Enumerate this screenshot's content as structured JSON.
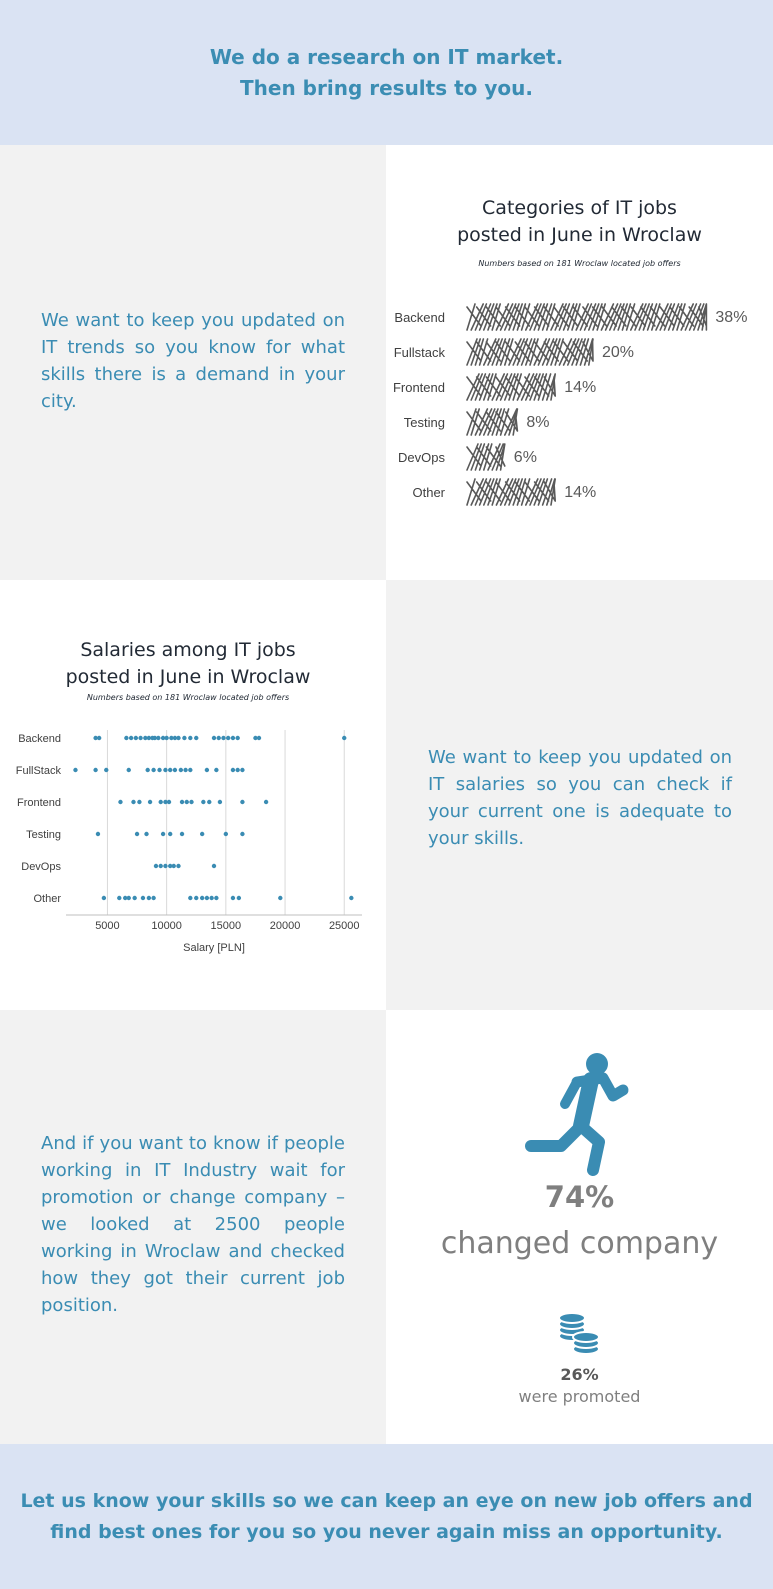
{
  "header": {
    "title": "We do a research on IT market.\nThen bring results to you."
  },
  "section1": {
    "text": "We want to keep you updated on IT trends so you know for what skills there is a demand in your city."
  },
  "section2": {
    "text": "We want to keep you updated on IT salaries so you can check if your current one is adequate to your skills."
  },
  "section3": {
    "text": "And if you want to know if people working in IT Industry wait for promotion or change company – we looked at 2500 people working in Wroclaw and checked how they got their current job position.",
    "changed_value": "74%",
    "changed_label": "changed company",
    "promoted_value": "26%",
    "promoted_label": "were promoted",
    "icons": [
      "running-person-icon",
      "coins-icon"
    ]
  },
  "footer": {
    "text": "Let us know your skills so we can keep an eye on new job offers and\nfind best ones for you so you never again miss an opportunity."
  },
  "colors": {
    "accent": "#3a8cb3",
    "band": "#dae3f3",
    "panel": "#f2f2f2",
    "hatch": "#595959",
    "dots": "#3a8cb3"
  },
  "chart_data": [
    {
      "type": "bar",
      "orientation": "horizontal",
      "title": "Categories of IT jobs\nposted in June in Wroclaw",
      "subtitle": "Numbers based on 181 Wroclaw located job offers",
      "categories": [
        "Backend",
        "Fullstack",
        "Frontend",
        "Testing",
        "DevOps",
        "Other"
      ],
      "values": [
        38,
        20,
        14,
        8,
        6,
        14
      ],
      "labels": [
        "38%",
        "20%",
        "14%",
        "8%",
        "6%",
        "14%"
      ],
      "style": "hand-drawn hatched bars",
      "grid": false
    },
    {
      "type": "scatter",
      "title": "Salaries among IT jobs\nposted in June in Wroclaw",
      "subtitle": "Numbers based on 181 Wroclaw located job offers",
      "xlabel": "Salary [PLN]",
      "xticks": [
        5000,
        10000,
        15000,
        20000,
        25000
      ],
      "xlim": [
        1500,
        26500
      ],
      "categories": [
        "Backend",
        "FullStack",
        "Frontend",
        "Testing",
        "DevOps",
        "Other"
      ],
      "series": [
        {
          "category": "Backend",
          "values": [
            4000,
            4300,
            6600,
            7000,
            7400,
            7800,
            8200,
            8500,
            8800,
            9000,
            9300,
            9700,
            10000,
            10400,
            10700,
            11000,
            11500,
            12000,
            12500,
            14000,
            14400,
            14800,
            15200,
            15600,
            16000,
            17500,
            17800,
            25000
          ]
        },
        {
          "category": "FullStack",
          "values": [
            2300,
            4000,
            4900,
            6800,
            8400,
            8900,
            9400,
            9900,
            10300,
            10700,
            11200,
            11600,
            12000,
            13400,
            14200,
            15600,
            16000,
            16400
          ]
        },
        {
          "category": "Frontend",
          "values": [
            6100,
            7200,
            7700,
            8600,
            9500,
            9900,
            10200,
            11300,
            11700,
            12100,
            13100,
            13600,
            14500,
            16400,
            18400
          ]
        },
        {
          "category": "Testing",
          "values": [
            4200,
            7500,
            8300,
            9700,
            10300,
            11300,
            13000,
            15000,
            16400
          ]
        },
        {
          "category": "DevOps",
          "values": [
            9100,
            9500,
            9900,
            10300,
            10600,
            11000,
            14000
          ]
        },
        {
          "category": "Other",
          "values": [
            4700,
            6000,
            6500,
            6800,
            7300,
            8000,
            8500,
            8900,
            12000,
            12500,
            13000,
            13400,
            13800,
            14200,
            15600,
            16100,
            19600,
            25600
          ]
        }
      ],
      "grid": "vertical"
    }
  ]
}
